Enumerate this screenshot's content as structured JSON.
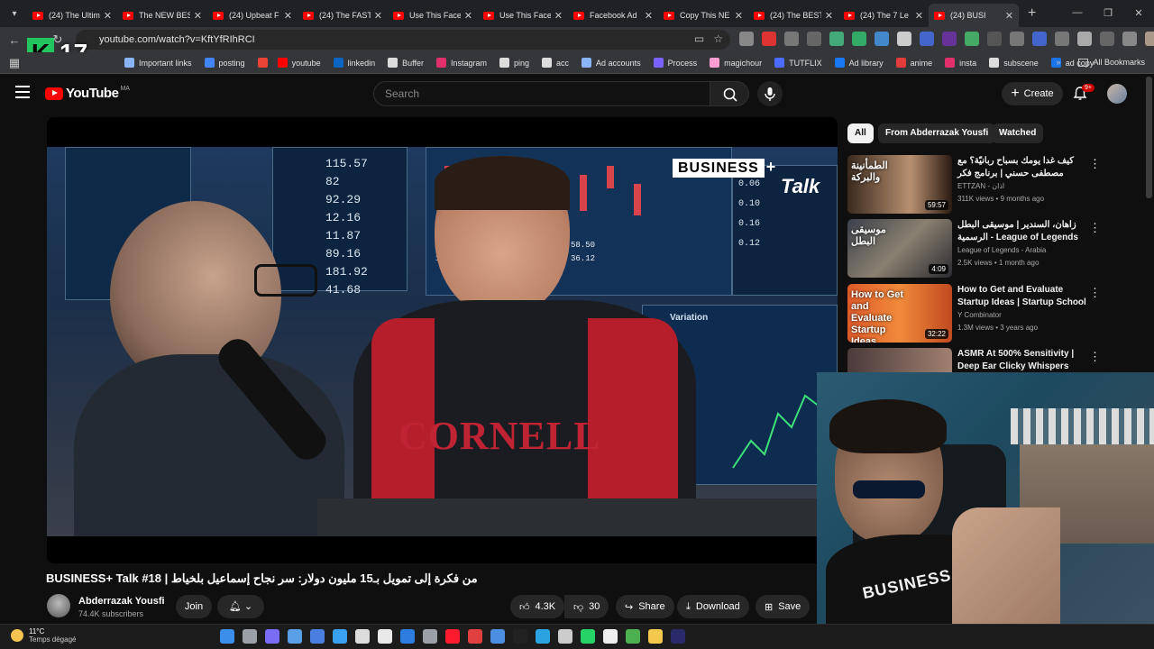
{
  "browser": {
    "tabs": [
      {
        "label": "(24) The Ultim",
        "kind": "yt"
      },
      {
        "label": "The NEW BES",
        "kind": "yt"
      },
      {
        "label": "(24) Upbeat F",
        "kind": "yt"
      },
      {
        "label": "(24) The FAST",
        "kind": "yt"
      },
      {
        "label": "Use This Face",
        "kind": "yt"
      },
      {
        "label": "Use This Face",
        "kind": "yt"
      },
      {
        "label": "Facebook Ad",
        "kind": "yt"
      },
      {
        "label": "Copy This NE",
        "kind": "yt"
      },
      {
        "label": "(24) The BEST",
        "kind": "yt"
      },
      {
        "label": "(24) The 7 Le",
        "kind": "yt"
      },
      {
        "label": "(24) BUSI",
        "kind": "yt",
        "active": true
      }
    ],
    "url": "youtube.com/watch?v=KftYfRIhRCI",
    "bookmarks": [
      {
        "label": "Important links",
        "color": "#8ab4f8"
      },
      {
        "label": "posting",
        "color": "#4285f4"
      },
      {
        "label": "",
        "color": "#ea4335"
      },
      {
        "label": "youtube",
        "color": "#ff0000"
      },
      {
        "label": "linkedin",
        "color": "#0a66c2"
      },
      {
        "label": "Buffer",
        "color": "#dddddd"
      },
      {
        "label": "Instagram",
        "color": "#e1306c"
      },
      {
        "label": "ping",
        "color": "#dddddd"
      },
      {
        "label": "acc",
        "color": "#dddddd"
      },
      {
        "label": "Ad accounts",
        "color": "#8ab4f8"
      },
      {
        "label": "Process",
        "color": "#7b61ff"
      },
      {
        "label": "magichour",
        "color": "#ff9ed2"
      },
      {
        "label": "TUTFLIX",
        "color": "#4b6cff"
      },
      {
        "label": "Ad library",
        "color": "#1877f2"
      },
      {
        "label": "anime",
        "color": "#e23b3b"
      },
      {
        "label": "insta",
        "color": "#e1306c"
      },
      {
        "label": "subscene",
        "color": "#dddddd"
      },
      {
        "label": "ad copy",
        "color": "#1a73e8"
      }
    ],
    "all_bookmarks": "All Bookmarks",
    "overlay_logo": {
      "letter": "K",
      "number": "17",
      "tag": "ayonne"
    }
  },
  "youtube": {
    "logo": "YouTube",
    "country": "MA",
    "search_placeholder": "Search",
    "create": "Create",
    "notif_count": "9+",
    "video": {
      "title": "BUSINESS+ Talk #18 | من فكرة إلى تمويل بـ15 مليون دولار: سر نجاح إسماعيل بلخياط",
      "channel": "Abderrazak Yousfi",
      "subscribers": "74.4K subscribers",
      "join": "Join",
      "likes": "4.3K",
      "dislikes": "30",
      "share": "Share",
      "download": "Download",
      "save": "Save",
      "brand_overlay": "BUSINESS",
      "brand_overlay2": "Talk",
      "screen_numbers": [
        "115.57",
        "82",
        "92.29",
        "12.16",
        "11.87",
        "89.16",
        "181.92",
        "41.68"
      ],
      "right_numbers": [
        "0.06",
        "0.10",
        "0.16",
        "0.12"
      ],
      "variation": "Variation",
      "shirt_text": "CORNELL"
    },
    "chips": [
      "All",
      "From Abderrazak Yousfi",
      "Watched"
    ],
    "recommendations": [
      {
        "title": "كيف غدا يومك بسباح ربانيّة؟ مع مصطفى حسني | برنامج فكر",
        "channel": "ETTZAN - اذان",
        "meta": "311K views • 9 months ago",
        "duration": "59:57",
        "thumb_text": "الطمأنينة والبركة"
      },
      {
        "title": "زاهان، السندير | موسيقى البطل الرسمية - League of Legends",
        "channel": "League of Legends - Arabia",
        "meta": "2.5K views • 1 month ago",
        "duration": "4:09",
        "thumb_text": "موسيقى البطل"
      },
      {
        "title": "How to Get and Evaluate Startup Ideas | Startup School",
        "channel": "Y Combinator",
        "meta": "1.3M views • 3 years ago",
        "duration": "32:22",
        "thumb_text": "How to Get and Evaluate Startup Ideas"
      },
      {
        "title": "ASMR At 500% Sensitivity | Deep Ear Clicky Whispers",
        "channel": "",
        "meta": "",
        "duration": "",
        "thumb_text": ""
      }
    ]
  },
  "webcam": {
    "shirt_text": "BUSINESS"
  },
  "taskbar": {
    "temp": "11°C",
    "weather": "Temps dégagé",
    "icons": [
      {
        "name": "windows-icon",
        "color": "#3b8eea"
      },
      {
        "name": "task-view-icon",
        "color": "#9aa0a6"
      },
      {
        "name": "copilot-icon",
        "color": "#7b6cf6"
      },
      {
        "name": "app-l-icon",
        "color": "#5aa0e6"
      },
      {
        "name": "app-s-icon",
        "color": "#4a7fe0"
      },
      {
        "name": "vscode-icon",
        "color": "#3aa0f0"
      },
      {
        "name": "notepad-icon",
        "color": "#dcdcdc"
      },
      {
        "name": "store-icon",
        "color": "#e9e9e9"
      },
      {
        "name": "mail-icon",
        "color": "#2d7de0"
      },
      {
        "name": "settings-icon",
        "color": "#9aa0a6"
      },
      {
        "name": "opera-icon",
        "color": "#ff1b2d"
      },
      {
        "name": "tv-icon",
        "color": "#e04040"
      },
      {
        "name": "qb-icon",
        "color": "#4a8fe0"
      },
      {
        "name": "tiktok-icon",
        "color": "#222222"
      },
      {
        "name": "telegram-icon",
        "color": "#2aa3e0"
      },
      {
        "name": "app-g-icon",
        "color": "#cccccc"
      },
      {
        "name": "whatsapp-icon",
        "color": "#25d366"
      },
      {
        "name": "notion-icon",
        "color": "#eeeeee"
      },
      {
        "name": "chrome-icon",
        "color": "#4caf50"
      },
      {
        "name": "explorer-icon",
        "color": "#f2c94c"
      },
      {
        "name": "premiere-icon",
        "color": "#2a2a6a"
      }
    ]
  }
}
